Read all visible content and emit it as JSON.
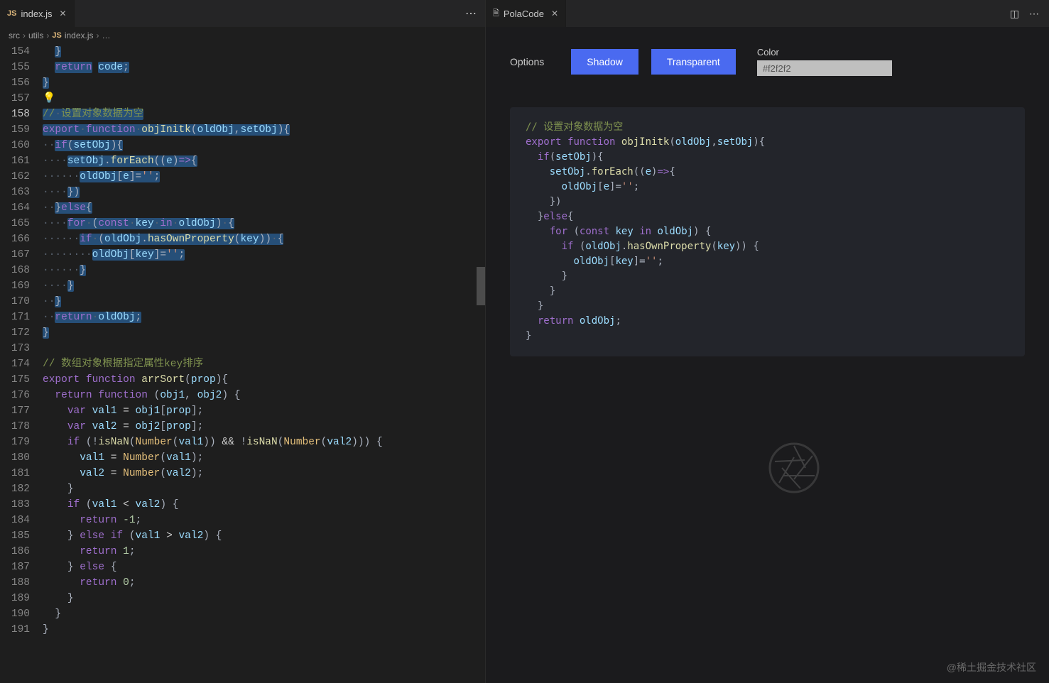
{
  "left": {
    "tab": {
      "icon_text": "JS",
      "label": "index.js"
    },
    "breadcrumb": {
      "a": "src",
      "b": "utils",
      "c_icon": "JS",
      "c": "index.js",
      "tail": "…"
    },
    "lines_seen": {
      "start": 154,
      "end": 191
    },
    "code_lines": [
      {
        "n": 154,
        "html": "  <span class='pn sel'>}</span>"
      },
      {
        "n": 155,
        "html": "  <span class='kw sel'>return</span> <span class='var sel'>code</span><span class='pn sel'>;</span>"
      },
      {
        "n": 156,
        "html": "<span class='pn sel'>}</span>"
      },
      {
        "n": 157,
        "html": "<span class='bulb'>💡</span>"
      },
      {
        "n": 158,
        "html": "<span class='sel'><span class='cmg'>//</span><span class='dots'>·</span><span class='cmg'>设置对象数据为空</span></span>",
        "current": true
      },
      {
        "n": 159,
        "html": "<span class='sel'><span class='kw'>export</span><span class='dots'>·</span><span class='kw'>function</span><span class='dots'>·</span><span class='fn'>objInitk</span><span class='pn'>(</span><span class='var'>oldObj</span><span class='pn'>,</span><span class='var'>setObj</span><span class='pn'>){</span></span>"
      },
      {
        "n": 160,
        "html": "<span class='dots'>··</span><span class='sel'><span class='kw'>if</span><span class='pn'>(</span><span class='var'>setObj</span><span class='pn'>){</span></span>"
      },
      {
        "n": 161,
        "html": "<span class='dots'>····</span><span class='sel'><span class='var'>setObj</span><span class='pn'>.</span><span class='fn'>forEach</span><span class='pn'>((</span><span class='var'>e</span><span class='pn'>)</span><span class='kw'>=></span><span class='pn'>{</span></span>"
      },
      {
        "n": 162,
        "html": "<span class='dots'>······</span><span class='sel'><span class='var'>oldObj</span><span class='pn'>[</span><span class='var'>e</span><span class='pn'>]=</span><span class='str'>''</span><span class='pn'>;</span></span>"
      },
      {
        "n": 163,
        "html": "<span class='dots'>····</span><span class='sel'><span class='pn'>})</span></span>"
      },
      {
        "n": 164,
        "html": "<span class='dots'>··</span><span class='sel'><span class='pn'>}</span><span class='kw'>else</span><span class='pn'>{</span></span>"
      },
      {
        "n": 165,
        "html": "<span class='dots'>····</span><span class='sel'><span class='kw'>for</span><span class='dots'>·</span><span class='pn'>(</span><span class='kw'>const</span><span class='dots'>·</span><span class='var'>key</span><span class='dots'>·</span><span class='kw'>in</span><span class='dots'>·</span><span class='var'>oldObj</span><span class='pn'>)</span><span class='dots'>·</span><span class='pn'>{</span></span>"
      },
      {
        "n": 166,
        "html": "<span class='dots'>······</span><span class='sel'><span class='kw'>if</span><span class='dots'>·</span><span class='pn'>(</span><span class='var'>oldObj</span><span class='pn'>.</span><span class='fn'>hasOwnProperty</span><span class='pn'>(</span><span class='var'>key</span><span class='pn'>))</span><span class='dots'>·</span><span class='pn'>{</span></span>"
      },
      {
        "n": 167,
        "html": "<span class='dots'>········</span><span class='sel'><span class='var'>oldObj</span><span class='pn'>[</span><span class='var'>key</span><span class='pn'>]=</span><span class='str'>''</span><span class='pn'>;</span></span>"
      },
      {
        "n": 168,
        "html": "<span class='dots'>······</span><span class='sel'><span class='pn'>}</span></span>"
      },
      {
        "n": 169,
        "html": "<span class='dots'>····</span><span class='sel'><span class='pn'>}</span></span>"
      },
      {
        "n": 170,
        "html": "<span class='dots'>··</span><span class='sel'><span class='pn'>}</span></span>"
      },
      {
        "n": 171,
        "html": "<span class='dots'>··</span><span class='sel'><span class='kw'>return</span><span class='dots'>·</span><span class='var'>oldObj</span><span class='pn'>;</span></span>"
      },
      {
        "n": 172,
        "html": "<span class='sel'><span class='pn'>}</span></span>"
      },
      {
        "n": 173,
        "html": ""
      },
      {
        "n": 174,
        "html": "<span class='cmg'>// 数组对象根据指定属性key排序</span>"
      },
      {
        "n": 175,
        "html": "<span class='kw'>export</span> <span class='kw'>function</span> <span class='fn'>arrSort</span><span class='pn'>(</span><span class='var'>prop</span><span class='pn'>){</span>"
      },
      {
        "n": 176,
        "html": "  <span class='kw'>return</span> <span class='kw'>function</span> <span class='pn'>(</span><span class='var'>obj1</span><span class='pn'>,</span> <span class='var'>obj2</span><span class='pn'>) {</span>"
      },
      {
        "n": 177,
        "html": "    <span class='kw'>var</span> <span class='var'>val1</span> <span class='op'>=</span> <span class='var'>obj1</span><span class='pn'>[</span><span class='var'>prop</span><span class='pn'>];</span>"
      },
      {
        "n": 178,
        "html": "    <span class='kw'>var</span> <span class='var'>val2</span> <span class='op'>=</span> <span class='var'>obj2</span><span class='pn'>[</span><span class='var'>prop</span><span class='pn'>];</span>"
      },
      {
        "n": 179,
        "html": "    <span class='kw'>if</span> <span class='pn'>(!</span><span class='fn'>isNaN</span><span class='pn'>(</span><span class='id'>Number</span><span class='pn'>(</span><span class='var'>val1</span><span class='pn'>))</span> <span class='op'>&amp;&amp;</span> <span class='pn'>!</span><span class='fn'>isNaN</span><span class='pn'>(</span><span class='id'>Number</span><span class='pn'>(</span><span class='var'>val2</span><span class='pn'>))) {</span>"
      },
      {
        "n": 180,
        "html": "      <span class='var'>val1</span> <span class='op'>=</span> <span class='id'>Number</span><span class='pn'>(</span><span class='var'>val1</span><span class='pn'>);</span>"
      },
      {
        "n": 181,
        "html": "      <span class='var'>val2</span> <span class='op'>=</span> <span class='id'>Number</span><span class='pn'>(</span><span class='var'>val2</span><span class='pn'>);</span>"
      },
      {
        "n": 182,
        "html": "    <span class='pn'>}</span>"
      },
      {
        "n": 183,
        "html": "    <span class='kw'>if</span> <span class='pn'>(</span><span class='var'>val1</span> <span class='op'>&lt;</span> <span class='var'>val2</span><span class='pn'>) {</span>"
      },
      {
        "n": 184,
        "html": "      <span class='kw'>return</span> <span class='num'>-1</span><span class='pn'>;</span>"
      },
      {
        "n": 185,
        "html": "    <span class='pn'>}</span> <span class='kw'>else</span> <span class='kw'>if</span> <span class='pn'>(</span><span class='var'>val1</span> <span class='op'>&gt;</span> <span class='var'>val2</span><span class='pn'>) {</span>"
      },
      {
        "n": 186,
        "html": "      <span class='kw'>return</span> <span class='num'>1</span><span class='pn'>;</span>"
      },
      {
        "n": 187,
        "html": "    <span class='pn'>}</span> <span class='kw'>else</span> <span class='pn'>{</span>"
      },
      {
        "n": 188,
        "html": "      <span class='kw'>return</span> <span class='num'>0</span><span class='pn'>;</span>"
      },
      {
        "n": 189,
        "html": "    <span class='pn'>}</span>"
      },
      {
        "n": 190,
        "html": "  <span class='pn'>}</span>"
      },
      {
        "n": 191,
        "html": "<span class='pn'>}</span>"
      }
    ]
  },
  "right": {
    "tab": {
      "label": "PolaCode"
    },
    "options_label": "Options",
    "shadow_btn": "Shadow",
    "transparent_btn": "Transparent",
    "color_label": "Color",
    "color_value": "#f2f2f2",
    "snippet_lines": [
      "<span class='cmg'>// 设置对象数据为空</span>",
      "<span class='kw'>export</span> <span class='kw'>function</span> <span class='fn'>objInitk</span><span class='pn'>(</span><span class='var'>oldObj</span><span class='pn'>,</span><span class='var'>setObj</span><span class='pn'>){</span>",
      "  <span class='kw'>if</span><span class='pn'>(</span><span class='var'>setObj</span><span class='pn'>){</span>",
      "    <span class='var'>setObj</span><span class='pn'>.</span><span class='fn'>forEach</span><span class='pn'>((</span><span class='var'>e</span><span class='pn'>)</span><span class='kw'>=></span><span class='pn'>{</span>",
      "      <span class='var'>oldObj</span><span class='pn'>[</span><span class='var'>e</span><span class='pn'>]=</span><span class='str'>''</span><span class='pn'>;</span>",
      "    <span class='pn'>})</span>",
      "  <span class='pn'>}</span><span class='kw'>else</span><span class='pn'>{</span>",
      "    <span class='kw'>for</span> <span class='pn'>(</span><span class='kw'>const</span> <span class='var'>key</span> <span class='kw'>in</span> <span class='var'>oldObj</span><span class='pn'>) {</span>",
      "      <span class='kw'>if</span> <span class='pn'>(</span><span class='var'>oldObj</span><span class='pn'>.</span><span class='fn'>hasOwnProperty</span><span class='pn'>(</span><span class='var'>key</span><span class='pn'>)) {</span>",
      "        <span class='var'>oldObj</span><span class='pn'>[</span><span class='var'>key</span><span class='pn'>]=</span><span class='str'>''</span><span class='pn'>;</span>",
      "      <span class='pn'>}</span>",
      "    <span class='pn'>}</span>",
      "  <span class='pn'>}</span>",
      "  <span class='kw'>return</span> <span class='var'>oldObj</span><span class='pn'>;</span>",
      "<span class='pn'>}</span>"
    ]
  },
  "watermark": "@稀土掘金技术社区"
}
